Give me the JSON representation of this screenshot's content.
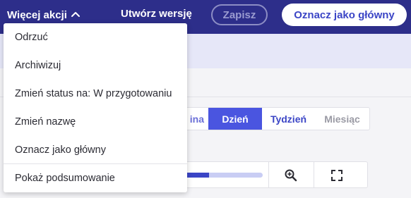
{
  "topbar": {
    "more_actions_label": "Więcej akcji",
    "create_version_label": "Utwórz wersję",
    "save_label": "Zapisz",
    "mark_primary_label": "Oznacz jako główny"
  },
  "dropdown": {
    "items": [
      {
        "label": "Odrzuć"
      },
      {
        "label": "Archiwizuj"
      },
      {
        "label": "Zmień status na: W przygotowaniu"
      },
      {
        "label": "Zmień nazwę"
      },
      {
        "label": "Oznacz jako główny"
      },
      {
        "label": "Pokaż podsumowanie"
      }
    ]
  },
  "view_switcher": {
    "partial_label": "ina",
    "options": [
      {
        "label": "Dzień",
        "active": true
      },
      {
        "label": "Tydzień",
        "active": false
      },
      {
        "label": "Miesiąc",
        "active": false
      }
    ]
  },
  "timeline_toolbar": {
    "progress_fraction": 0.4,
    "icons": [
      "zoom-in-icon",
      "fullscreen-icon"
    ]
  },
  "colors": {
    "topbar_bg": "#2d2e8a",
    "accent": "#4a55e0",
    "accent_dark": "#3b45c6",
    "track_light": "#c9cdf4"
  }
}
